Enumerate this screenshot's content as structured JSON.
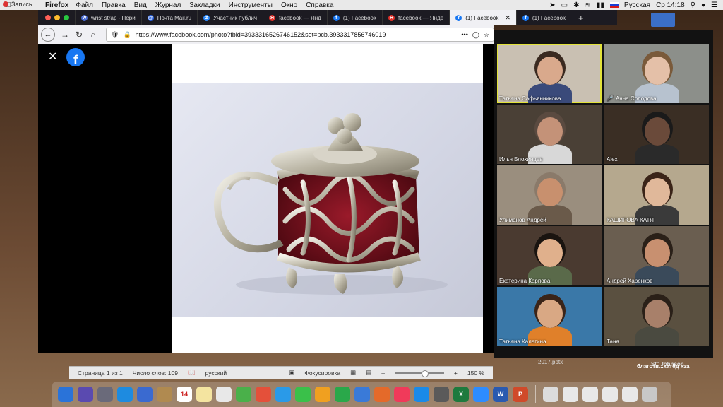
{
  "recording": {
    "label": "Запись..."
  },
  "menubar": {
    "app": "Firefox",
    "menus": [
      "Файл",
      "Правка",
      "Вид",
      "Журнал",
      "Закладки",
      "Инструменты",
      "Окно",
      "Справка"
    ],
    "input_source": "Русская",
    "clock": "Ср 14:18"
  },
  "tabs": [
    {
      "title": "wrist strap - Пери",
      "fav_color": "#4a6cd4",
      "fav": "w"
    },
    {
      "title": "Почта Mail.ru",
      "fav_color": "#2660e0",
      "fav": "@"
    },
    {
      "title": "Участник публич",
      "fav_color": "#2d8cff",
      "fav": "z"
    },
    {
      "title": "facebook — Янд",
      "fav_color": "#e0322a",
      "fav": "Я"
    },
    {
      "title": "(1) Facebook",
      "fav_color": "#1877f2",
      "fav": "f"
    },
    {
      "title": "facebook — Янде",
      "fav_color": "#e0322a",
      "fav": "Я"
    },
    {
      "title": "(1) Facebook",
      "fav_color": "#1877f2",
      "fav": "f",
      "active": true
    },
    {
      "title": "(1) Facebook",
      "fav_color": "#1877f2",
      "fav": "f"
    }
  ],
  "navbar": {
    "url": "https://www.facebook.com/photo?fbid=3933316526746152&set=pcb.3933317856746019"
  },
  "viewer": {
    "close": "✕",
    "logo": "f"
  },
  "participants": [
    {
      "name": "Татьяна Сафьянникова",
      "speaking": true,
      "bg": "#c9c0b2",
      "skin": "#d9a98c",
      "shirt": "#3a4a7a",
      "hair": "#3a2a20"
    },
    {
      "name": "Анна Солодова",
      "muted": true,
      "bg": "#8c8f8a",
      "skin": "#e4c0a8",
      "shirt": "#b7c2cf",
      "hair": "#7a5a3a"
    },
    {
      "name": "Илья Блохинцев",
      "bg": "#4a4036",
      "skin": "#c49278",
      "shirt": "#d8d8d8",
      "hair": "#5a4a40"
    },
    {
      "name": "Alex",
      "bg": "#3a2e24",
      "skin": "#6a4a3a",
      "shirt": "#2a2a2a",
      "hair": "#1a1a1a"
    },
    {
      "name": "Улиманов Андрей",
      "bg": "#9a8e7e",
      "skin": "#c8906e",
      "shirt": "#6a5a4a",
      "hair": "#8a7a6a"
    },
    {
      "name": "КАШИРОВА КАТЯ",
      "bg": "#b5a88e",
      "skin": "#e0b89a",
      "shirt": "#3a3a3a",
      "hair": "#3a2418"
    },
    {
      "name": "Екатерина Карпова",
      "bg": "#4a3a30",
      "skin": "#e0b08c",
      "shirt": "#5a6a4a",
      "hair": "#1a1410"
    },
    {
      "name": "Андрей Харенков",
      "bg": "#6a5e50",
      "skin": "#c89070",
      "shirt": "#3a4a5a",
      "hair": "#2a2018"
    },
    {
      "name": "Татьяна Калагина",
      "bg": "#3a78a8",
      "skin": "#d9a884",
      "shirt": "#e0802a",
      "hair": "#3a2418"
    },
    {
      "name": "Таня",
      "bg": "#5a5040",
      "skin": "#a8806a",
      "shirt": "#4a4a40",
      "hair": "#2a2018"
    }
  ],
  "wordbar": {
    "page": "Страница 1 из 1",
    "words": "Число слов: 109",
    "lang": "русский",
    "focus": "Фокусировка",
    "zoom": "150 %"
  },
  "background_text": {
    "file": "2017.pptx",
    "right1": "SC Johnson",
    "right2": "благотв...катёд хза"
  },
  "dock": [
    {
      "label": "",
      "color": "#2a73d9"
    },
    {
      "label": "",
      "color": "#5a4ab0"
    },
    {
      "label": "",
      "color": "#6a6a7a"
    },
    {
      "label": "",
      "color": "#1e8be0"
    },
    {
      "label": "",
      "color": "#3a6ad0"
    },
    {
      "label": "",
      "color": "#b08a50"
    },
    {
      "label": "14",
      "color": "#ffffff"
    },
    {
      "label": "",
      "color": "#f4e4a0"
    },
    {
      "label": "",
      "color": "#e8e8e8"
    },
    {
      "label": "",
      "color": "#4ab04a"
    },
    {
      "label": "",
      "color": "#e4503a"
    },
    {
      "label": "",
      "color": "#2a9ae8"
    },
    {
      "label": "",
      "color": "#3ac04a"
    },
    {
      "label": "",
      "color": "#f0a020"
    },
    {
      "label": "",
      "color": "#2aa84a"
    },
    {
      "label": "",
      "color": "#3a7ad8"
    },
    {
      "label": "",
      "color": "#e46a2a"
    },
    {
      "label": "",
      "color": "#f03a5a"
    },
    {
      "label": "",
      "color": "#1a8ae8"
    },
    {
      "label": "",
      "color": "#5a5a5a"
    },
    {
      "label": "X",
      "color": "#1e7a3e"
    },
    {
      "label": "",
      "color": "#2d8cff"
    },
    {
      "label": "W",
      "color": "#2a5ab0"
    },
    {
      "label": "P",
      "color": "#d04a2a"
    },
    {
      "label": "",
      "color": "#dcdcdc"
    },
    {
      "label": "",
      "color": "#e8e8e8"
    },
    {
      "label": "",
      "color": "#e8e8e8"
    },
    {
      "label": "",
      "color": "#e8e8e8"
    },
    {
      "label": "",
      "color": "#e8e8e8"
    },
    {
      "label": "",
      "color": "#c8c8c8"
    }
  ]
}
